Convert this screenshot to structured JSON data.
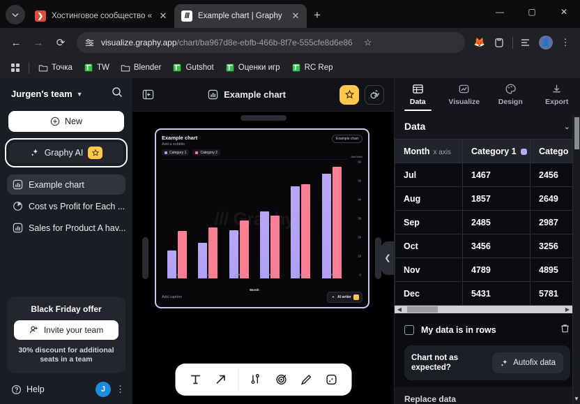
{
  "browser": {
    "tabs": [
      {
        "title": "Хостинговое сообщество «Tim",
        "favicon": "red-arrow-icon",
        "active": false
      },
      {
        "title": "Example chart | Graphy",
        "favicon": "graphy-icon",
        "active": true
      }
    ],
    "new_tab_label": "+",
    "url_prefix": "visualize.graphy.app",
    "url_suffix": "/chart/ba967d8e-ebfb-466b-8f7e-555cfe8d6e86",
    "bookmarks": [
      {
        "label": "Точка",
        "icon": "folder-icon"
      },
      {
        "label": "TW",
        "icon": "bookmark-green-icon"
      },
      {
        "label": "Blender",
        "icon": "folder-icon"
      },
      {
        "label": "Gutshot",
        "icon": "bookmark-green-icon"
      },
      {
        "label": "Оценки игр",
        "icon": "bookmark-green-icon"
      },
      {
        "label": "RC Rep",
        "icon": "bookmark-green-icon"
      }
    ],
    "window_controls": [
      "minimize",
      "maximize",
      "close"
    ]
  },
  "sidebar": {
    "team_name": "Jurgen's team",
    "new_button": "New",
    "ai_button": "Graphy AI",
    "items": [
      {
        "label": "Example chart",
        "icon": "bar-chart-icon",
        "selected": true
      },
      {
        "label": "Cost vs Profit for Each ...",
        "icon": "pie-chart-icon",
        "selected": false
      },
      {
        "label": "Sales for Product A hav...",
        "icon": "bar-chart-icon",
        "selected": false
      }
    ],
    "promo": {
      "title": "Black Friday offer",
      "button": "Invite your team",
      "note": "30% discount for additional seats in a team"
    },
    "help_label": "Help",
    "avatar_initial": "J"
  },
  "canvas": {
    "title": "Example chart",
    "collapse_icon": "panel-collapse-icon",
    "star_icon": "star-icon",
    "copy_icon": "duplicate-icon",
    "toolbar": [
      {
        "name": "text-tool",
        "glyph": "T"
      },
      {
        "name": "arrow-tool",
        "glyph": "↗"
      },
      {
        "name": "annotate-tool",
        "glyph": "chart-annotate"
      },
      {
        "name": "target-tool",
        "glyph": "target"
      },
      {
        "name": "highlighter-tool",
        "glyph": "pen"
      },
      {
        "name": "shape-tool",
        "glyph": "line-box"
      }
    ]
  },
  "chart_data": {
    "type": "bar",
    "title": "Example chart",
    "subtitle": "Add a subtitle",
    "caption": "Add caption",
    "badge": "Example chart",
    "ai_writer_label": "AI writer",
    "xlabel": "Month",
    "ylabel": "Add label",
    "categories": [
      "Jul",
      "Aug",
      "Sep",
      "Oct",
      "Nov",
      "Dec"
    ],
    "series": [
      {
        "name": "Category 1",
        "color": "#b0a0f5",
        "values": [
          1467,
          1857,
          2485,
          3456,
          4789,
          5431
        ]
      },
      {
        "name": "Category 2",
        "color": "#f97d94",
        "values": [
          2456,
          2649,
          2987,
          3256,
          4895,
          5781
        ]
      }
    ],
    "ylim": [
      0,
      6000
    ],
    "yticks": [
      "0",
      "1k",
      "2k",
      "3k",
      "4k",
      "5k",
      "6k"
    ],
    "grid": false,
    "legend_position": "top-left",
    "watermark": "Graphy"
  },
  "right_panel": {
    "tabs": [
      {
        "label": "Data",
        "icon": "table-icon",
        "active": true
      },
      {
        "label": "Visualize",
        "icon": "line-chart-icon",
        "active": false
      },
      {
        "label": "Design",
        "icon": "palette-icon",
        "active": false
      },
      {
        "label": "Export",
        "icon": "download-icon",
        "active": false
      }
    ],
    "section_title": "Data",
    "table": {
      "columns": [
        {
          "label": "Month",
          "sub": "x axis",
          "dot": null
        },
        {
          "label": "Category 1",
          "sub": "",
          "dot": "#b9a7f7"
        },
        {
          "label": "Catego",
          "sub": "",
          "dot": null
        }
      ],
      "rows": [
        [
          "Jul",
          "1467",
          "2456"
        ],
        [
          "Aug",
          "1857",
          "2649"
        ],
        [
          "Sep",
          "2485",
          "2987"
        ],
        [
          "Oct",
          "3456",
          "3256"
        ],
        [
          "Nov",
          "4789",
          "4895"
        ],
        [
          "Dec",
          "5431",
          "5781"
        ]
      ]
    },
    "rows_checkbox_label": "My data is in rows",
    "delete_icon": "trash-icon",
    "fix_prompt": "Chart not as expected?",
    "autofix_label": "Autofix data",
    "replace_label": "Replace data"
  }
}
